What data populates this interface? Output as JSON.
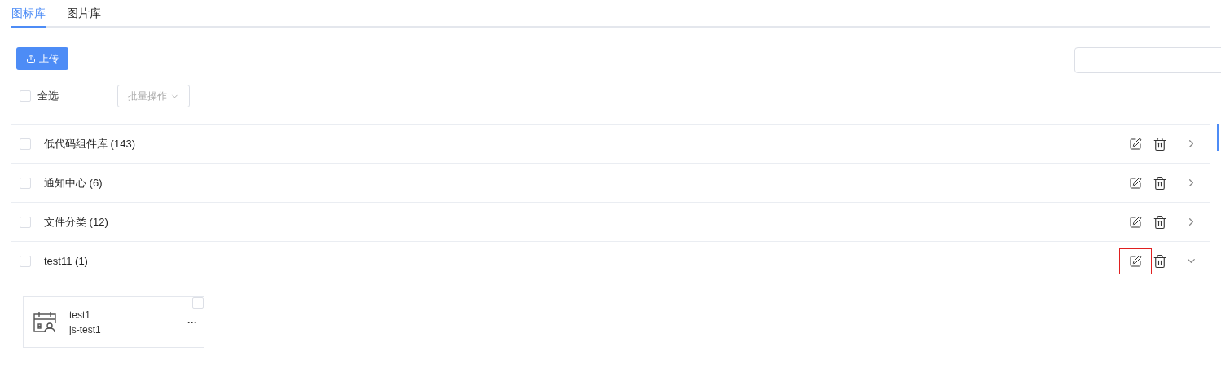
{
  "tabs": [
    {
      "label": "图标库",
      "selected": true
    },
    {
      "label": "图片库",
      "selected": false
    }
  ],
  "upload_button": "上传",
  "select_all": {
    "label": "全选",
    "checked": false
  },
  "batch_action": {
    "label": "批量操作",
    "disabled": true
  },
  "groups": [
    {
      "name": "低代码组件库 (143)",
      "checked": false,
      "expanded": false,
      "edit_focused": false
    },
    {
      "name": "通知中心 (6)",
      "checked": false,
      "expanded": false,
      "edit_focused": false
    },
    {
      "name": "文件分类 (12)",
      "checked": false,
      "expanded": false,
      "edit_focused": false
    },
    {
      "name": "test11 (1)",
      "checked": false,
      "expanded": true,
      "edit_focused": true,
      "icons": [
        {
          "name": "test1",
          "code": "js-test1",
          "checked": false,
          "more": "···"
        }
      ]
    }
  ]
}
